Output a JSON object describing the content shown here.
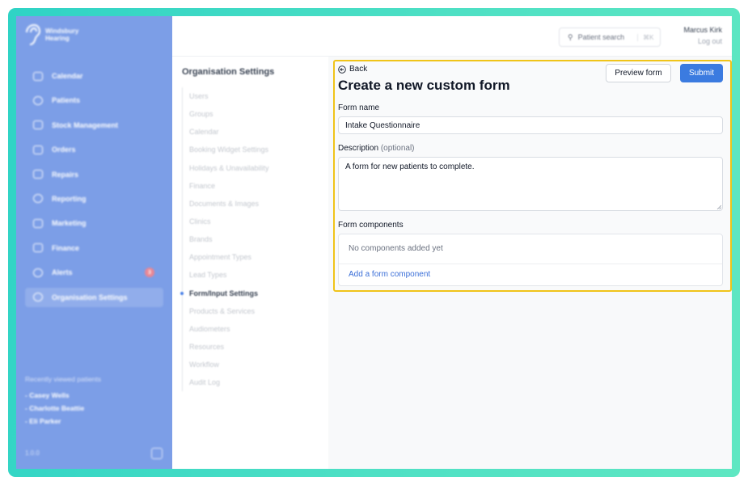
{
  "brand": {
    "name": "Windsbury Hearing"
  },
  "sidebar": {
    "items": [
      {
        "label": "Calendar",
        "icon": "calendar-icon"
      },
      {
        "label": "Patients",
        "icon": "smiley-icon"
      },
      {
        "label": "Stock Management",
        "icon": "clipboard-icon"
      },
      {
        "label": "Orders",
        "icon": "calendar-check-icon"
      },
      {
        "label": "Repairs",
        "icon": "wrench-icon"
      },
      {
        "label": "Reporting",
        "icon": "pie-chart-icon"
      },
      {
        "label": "Marketing",
        "icon": "mail-icon"
      },
      {
        "label": "Finance",
        "icon": "credit-card-icon"
      },
      {
        "label": "Alerts",
        "icon": "bell-icon",
        "badge": "3"
      },
      {
        "label": "Organisation Settings",
        "icon": "gear-icon",
        "active": true
      }
    ],
    "recent_title": "Recently viewed patients",
    "recent": [
      "- Casey Wells",
      "- Charlotte Beattie",
      "- Eli Parker"
    ],
    "version": "1.0.0"
  },
  "topbar": {
    "search_label": "Patient search",
    "search_shortcut": "⌘K",
    "user_name": "Marcus Kirk",
    "logout_label": "Log out"
  },
  "settings": {
    "title": "Organisation Settings",
    "items": [
      {
        "label": "Users"
      },
      {
        "label": "Groups"
      },
      {
        "label": "Calendar"
      },
      {
        "label": "Booking Widget Settings"
      },
      {
        "label": "Holidays & Unavailability"
      },
      {
        "label": "Finance"
      },
      {
        "label": "Documents & Images"
      },
      {
        "label": "Clinics"
      },
      {
        "label": "Brands"
      },
      {
        "label": "Appointment Types"
      },
      {
        "label": "Lead Types"
      },
      {
        "label": "Form/Input Settings",
        "active": true
      },
      {
        "label": "Products & Services"
      },
      {
        "label": "Audiometers"
      },
      {
        "label": "Resources"
      },
      {
        "label": "Workflow"
      },
      {
        "label": "Audit Log"
      }
    ]
  },
  "form": {
    "back_label": "Back",
    "title": "Create a new custom form",
    "preview_label": "Preview form",
    "submit_label": "Submit",
    "name_label": "Form name",
    "name_value": "Intake Questionnaire",
    "description_label": "Description",
    "description_optional": "(optional)",
    "description_value": "A form for new patients to complete.",
    "components_label": "Form components",
    "components_empty": "No components added yet",
    "add_component_label": "Add a form component"
  },
  "colors": {
    "frame_gradient_start": "#2fd3c5",
    "frame_gradient_end": "#5fe7c2",
    "sidebar_bg": "#7c9ee7",
    "primary": "#3b7be0",
    "link": "#3b6fd8",
    "highlight_border": "#f0c419",
    "alert_badge": "#e98693"
  }
}
